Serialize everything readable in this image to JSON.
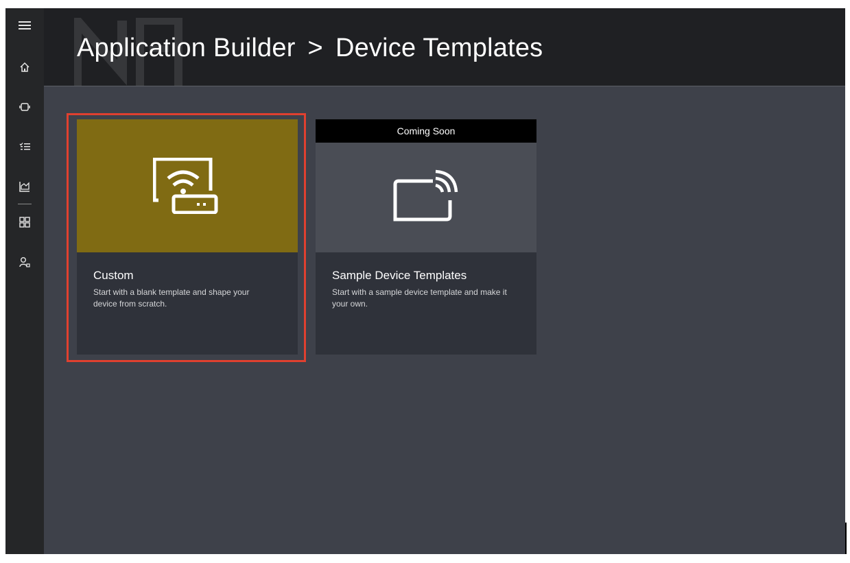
{
  "header": {
    "breadcrumb_root": "Application Builder",
    "breadcrumb_separator": ">",
    "breadcrumb_current": "Device Templates"
  },
  "nav_rail": {
    "items": [
      {
        "icon": "hamburger-menu-icon"
      },
      {
        "icon": "home-icon"
      },
      {
        "icon": "device-icon"
      },
      {
        "icon": "rules-list-icon"
      },
      {
        "icon": "analytics-chart-icon"
      },
      {
        "icon": "app-grid-icon"
      },
      {
        "icon": "users-admin-icon"
      }
    ]
  },
  "cards": [
    {
      "title": "Custom",
      "description": "Start with a blank template and shape your device from scratch.",
      "icon": "custom-device-wifi-icon",
      "banner_color": "#806b13",
      "selected": true
    },
    {
      "title": "Sample Device Templates",
      "description": "Start with a sample device template and make it your own.",
      "icon": "sample-device-signal-icon",
      "banner_color": "#4a4d55",
      "badge": "Coming Soon"
    }
  ],
  "colors": {
    "highlight": "#e0402f",
    "background": "#3e414a",
    "header": "#1f2023",
    "rail": "#252628"
  }
}
